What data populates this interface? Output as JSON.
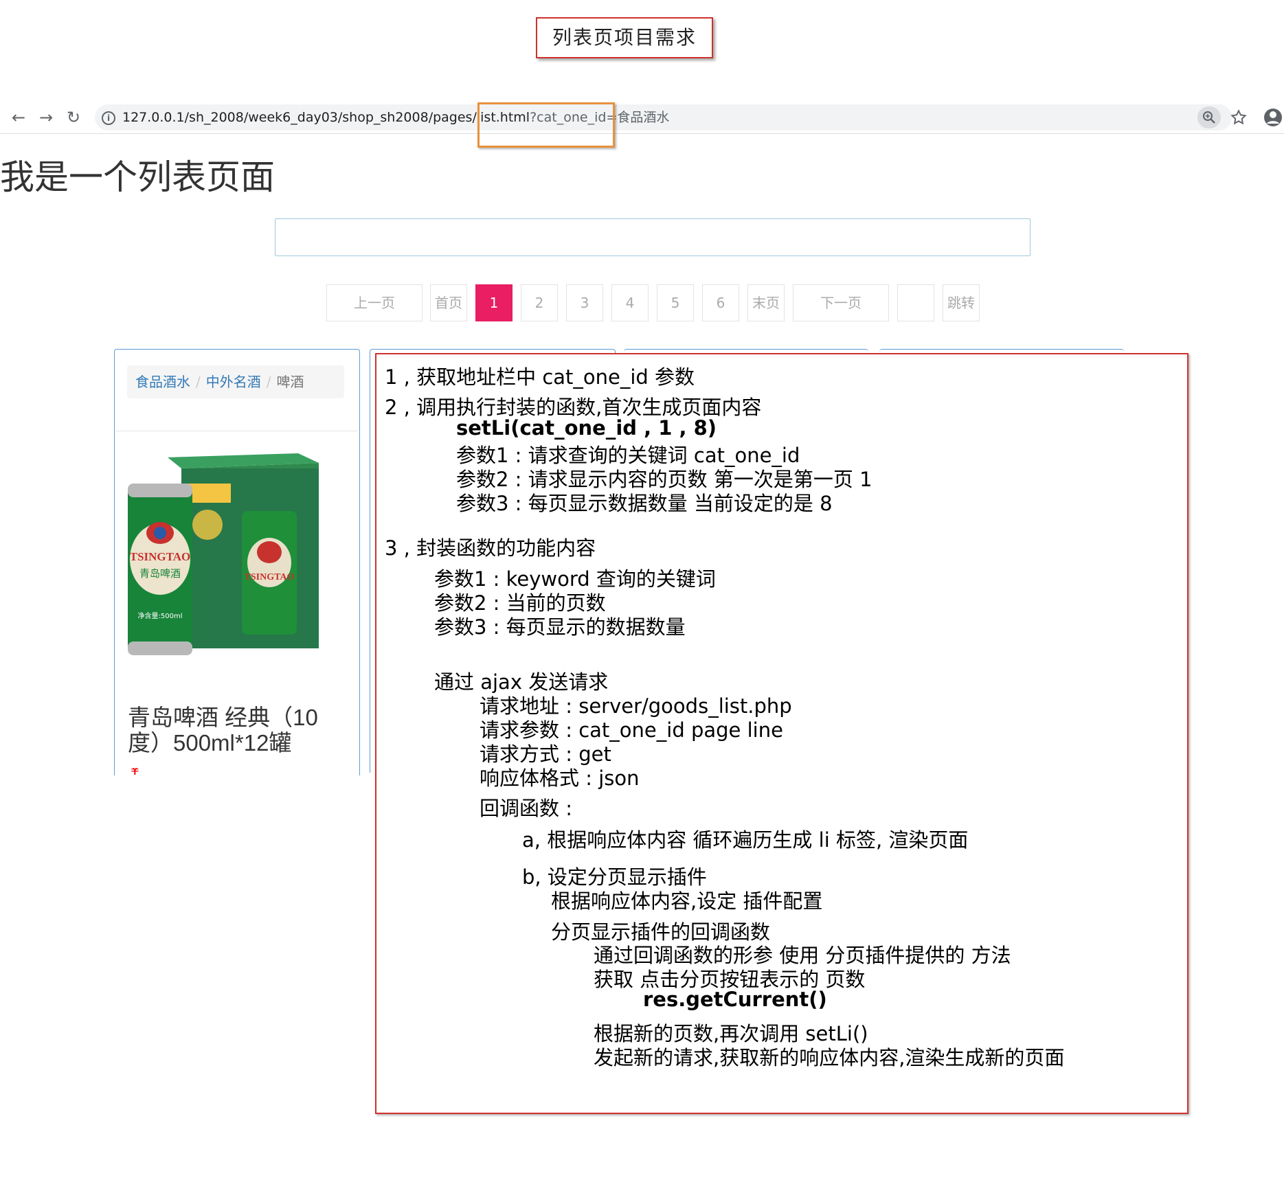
{
  "title_box": "列表页项目需求",
  "browser": {
    "nav": {
      "back": "←",
      "forward": "→",
      "reload": "↻"
    },
    "url_main": "127.0.0.1/sh_2008/week6_day03/shop_sh2008/pages/list.html",
    "url_query": "?cat_one_id=食品酒水",
    "icons": {
      "info": "info-icon",
      "zoom": "zoom-icon",
      "star": "star-icon",
      "profile": "profile-icon"
    }
  },
  "page": {
    "heading": "我是一个列表页面",
    "search_value": ""
  },
  "pagination": {
    "prev": "上一页",
    "first": "首页",
    "pages": [
      "1",
      "2",
      "3",
      "4",
      "5",
      "6"
    ],
    "active_page": "1",
    "last": "末页",
    "next": "下一页",
    "jump_input": "",
    "jump": "跳转",
    "active_color": "#e91e63"
  },
  "product": {
    "breadcrumb": [
      "食品酒水",
      "中外名酒",
      "啤酒"
    ],
    "name": "青岛啤酒 经典（10度）500ml*12罐",
    "image_texts": {
      "brand": "TSINGTAO",
      "brand_cn": "青岛啤酒",
      "volume": "净含量:500ml"
    }
  },
  "notes": {
    "l1": "1 , 获取地址栏中 cat_one_id 参数",
    "l2": "2 , 调用执行封装的函数,首次生成页面内容",
    "l3": "setLi(cat_one_id , 1 , 8)",
    "l4": "参数1 : 请求查询的关键词 cat_one_id",
    "l5": "参数2 : 请求显示内容的页数  第一次是第一页  1",
    "l6": "参数3 : 每页显示数据数量  当前设定的是 8",
    "l7": "3 , 封装函数的功能内容",
    "l8": "参数1 : keyword 查询的关键词",
    "l9": "参数2 : 当前的页数",
    "l10": "参数3 : 每页显示的数据数量",
    "l11": "通过 ajax 发送请求",
    "l12": "请求地址 : server/goods_list.php",
    "l13": "请求参数 : cat_one_id    page    line",
    "l14": "请求方式 : get",
    "l15": "响应体格式 : json",
    "l16": "回调函数 :",
    "l17": "a, 根据响应体内容  循环遍历生成  li 标签, 渲染页面",
    "l18": "b, 设定分页显示插件",
    "l19": "根据响应体内容,设定 插件配置",
    "l20": "分页显示插件的回调函数",
    "l21": "通过回调函数的形参 使用 分页插件提供的 方法",
    "l22": "获取 点击分页按钮表示的 页数",
    "l23": "res.getCurrent()",
    "l24": "根据新的页数,再次调用 setLi()",
    "l25": "发起新的请求,获取新的响应体内容,渲染生成新的页面"
  },
  "colors": {
    "note_border": "#d0312d",
    "url_highlight": "#e8913b",
    "link": "#337ab7"
  }
}
